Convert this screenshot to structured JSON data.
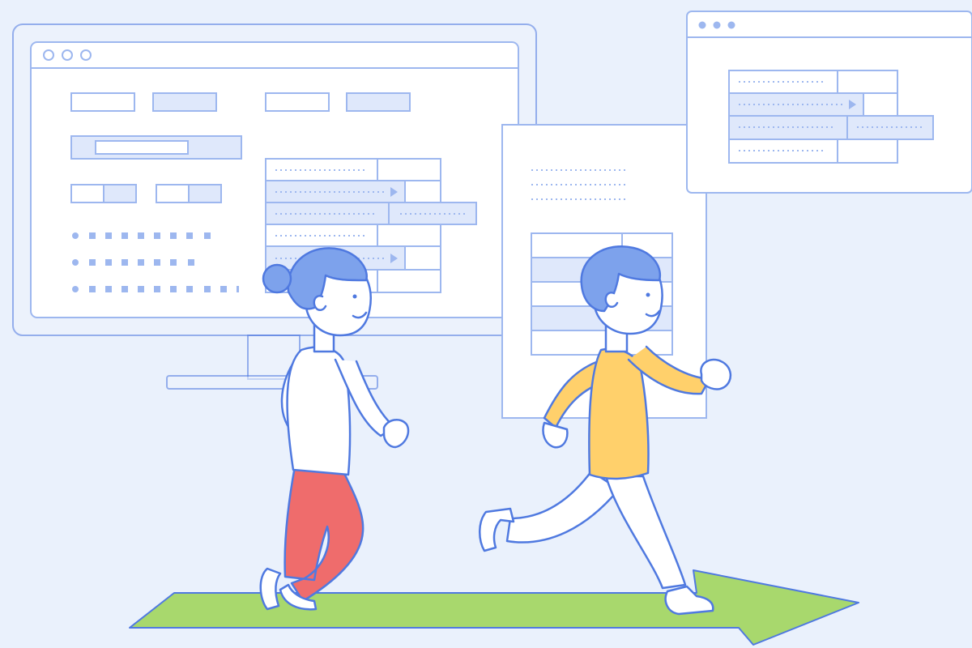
{
  "scene": {
    "palette": {
      "background": "#eaf1fc",
      "outline": "#4f79e0",
      "outline_light": "#9db7ef",
      "panel_fill": "#ffffff",
      "panel_shade": "#dfe8fb",
      "hair": "#7da2ec",
      "skin": "#ffffff",
      "shirt_boy": "#ffd06b",
      "pants_girl": "#ef6c6c",
      "arrow": "#a8d86d"
    },
    "monitor": {
      "icons": [
        "window-dot-icon",
        "window-dot-icon",
        "window-dot-icon"
      ]
    },
    "browser_window": {
      "icons": [
        "window-dot-icon",
        "window-dot-icon",
        "window-dot-icon"
      ]
    },
    "figures": [
      "girl-runner",
      "boy-runner"
    ],
    "floor": "green-arrow"
  }
}
